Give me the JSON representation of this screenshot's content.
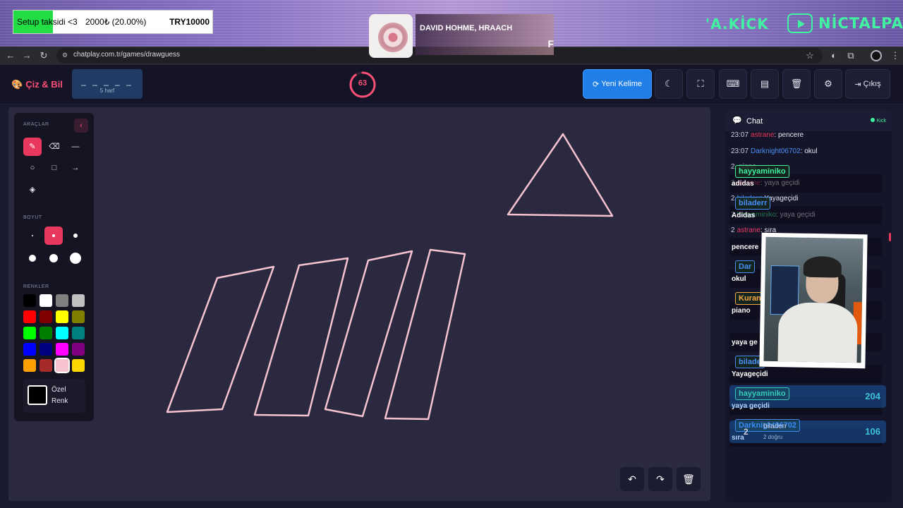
{
  "stream": {
    "donation": {
      "title": "Setup taksidi <3",
      "amount": "2000₺ (20.00%)",
      "goal": "TRY10000",
      "progress": 0.2
    },
    "music": {
      "artist": "DAVID HOHME, HRAACH",
      "title_fragment": "F"
    },
    "brand_left": "'A.KİCK",
    "brand_right": "NİCTALPA"
  },
  "browser": {
    "url": "chatplay.com.tr/games/drawguess",
    "icons": [
      "back-icon",
      "forward-icon",
      "reload-icon",
      "site-info-icon",
      "bookmark-star-icon",
      "extension-icon",
      "puzzle-icon",
      "profile-avatar",
      "more-icon"
    ]
  },
  "header": {
    "logo": "Çiz & Bil",
    "word": {
      "dashes": "_ _ _ _ _",
      "hint": "5 harf"
    },
    "timer": {
      "value": "63",
      "fraction": 0.9
    },
    "new_word_label": "Yeni Kelime",
    "exit_label": "Çıkış",
    "accent": "#ff4f75",
    "primary": "#1f7ee8"
  },
  "tools": {
    "tools_label": "ARAÇLAR",
    "size_label": "BOYUT",
    "colors_label": "RENKLER",
    "custom_color": {
      "line1": "Özel",
      "line2": "Renk"
    },
    "palette": [
      "#000000",
      "#ffffff",
      "#808080",
      "#c0c0c0",
      "#ff0000",
      "#800000",
      "#ffff00",
      "#808000",
      "#00ff00",
      "#008000",
      "#00ffff",
      "#008080",
      "#0000ff",
      "#000080",
      "#ff00ff",
      "#800080",
      "#ff9f00",
      "#a52a2a",
      "#f7c3d0",
      "#ffd700"
    ],
    "selected_color": "#f7c3d0",
    "selected_size_index": 1
  },
  "chat": {
    "title": "Chat",
    "platform": "Kick",
    "messages": [
      {
        "time": "23:07",
        "user": "astrane",
        "user_color": "#e8385e",
        "text": "pencere"
      },
      {
        "time": "23:07",
        "user": "Darknight06702",
        "user_color": "#4a8ff7",
        "text": "okul"
      },
      {
        "time": "2",
        "user": "",
        "user_color": "#41f3a0",
        "text": "piano"
      },
      {
        "time": "2",
        "user": "astrane",
        "user_color": "#e8385e",
        "text": "yaya geçidi"
      },
      {
        "time": "2",
        "user": "biladerr",
        "user_color": "#4a8ff7",
        "text": "Yayageçidi"
      },
      {
        "time": "2",
        "user": "hayyaminiko",
        "user_color": "#41f3a0",
        "text": "yaya geçidi"
      },
      {
        "time": "2",
        "user": "astrane",
        "user_color": "#e8385e",
        "text": "sıra"
      }
    ],
    "guess_overlays": [
      {
        "user": "hayyaminiko",
        "user_color": "#41f3a0",
        "word": "adidas"
      },
      {
        "user": "biladerr",
        "user_color": "#4a8ff7",
        "word": "Adidas"
      },
      {
        "user": "",
        "user_color": "#e8385e",
        "word": "pencere"
      },
      {
        "user": "Dar",
        "user_color": "#4a8ff7",
        "word": "okul"
      },
      {
        "user": "Kuran",
        "user_color": "#f5a742",
        "word": "piano"
      },
      {
        "user": "",
        "user_color": "#41f3a0",
        "word": "yaya ge"
      },
      {
        "user": "bilade",
        "user_color": "#4a8ff7",
        "word": "Yayageçidi"
      },
      {
        "user": "hayyaminiko",
        "user_color": "#41f3a0",
        "word": "yaya geçidi"
      },
      {
        "user": "Darknight06702",
        "user_color": "#4a8ff7",
        "word": "sıra"
      }
    ],
    "leaderboard": [
      {
        "rank": "",
        "name": "",
        "sub": "",
        "score": "204"
      },
      {
        "rank": "2",
        "name": "biladerr",
        "sub": "2 doğru",
        "score": "106"
      }
    ]
  }
}
